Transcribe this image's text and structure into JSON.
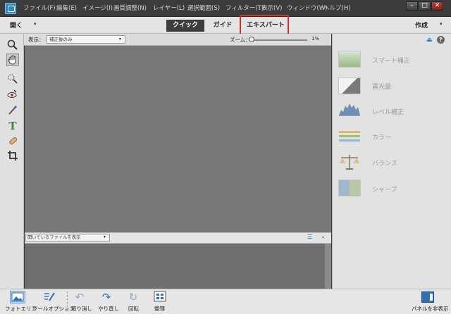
{
  "menubar": {
    "items": [
      "ファイル(F)",
      "編集(E)",
      "イメージ(I)",
      "画質調整(N)",
      "レイヤー(L)",
      "選択範囲(S)",
      "フィルター(T)",
      "表示(V)",
      "ウィンドウ(W)",
      "ヘルプ(H)"
    ],
    "window_controls": {
      "minimize": "–",
      "maximize": "□",
      "close": "✕"
    }
  },
  "modebar": {
    "open_label": "開く",
    "tabs": [
      "クイック",
      "ガイド",
      "エキスパート"
    ],
    "active_tab": "クイック",
    "highlighted_tab": "エキスパート",
    "create_label": "作成",
    "dropdown_caret": "▾"
  },
  "options": {
    "view_label": "表示：",
    "view_value": "補正後のみ",
    "zoom_label": "ズーム：",
    "zoom_value": "1%"
  },
  "tools": [
    "zoom",
    "hand",
    "quick-selection",
    "red-eye",
    "whiten-teeth",
    "type",
    "spot-healing",
    "crop"
  ],
  "photo_bin": {
    "select_value": "開いているファイルを表示"
  },
  "right_panel": {
    "items": [
      "スマート補正",
      "露光量",
      "レベル補正",
      "カラー",
      "バランス",
      "シャープ"
    ],
    "help": "?"
  },
  "bottombar": {
    "items": [
      "フォトエリア",
      "ツールオプション",
      "取り消し",
      "やり直し",
      "回転",
      "整理"
    ],
    "panel_toggle": "パネルを非表示"
  },
  "colors": {
    "accent": "#2f6fb2",
    "highlight": "#e32b2b",
    "canvas": "#777777"
  }
}
